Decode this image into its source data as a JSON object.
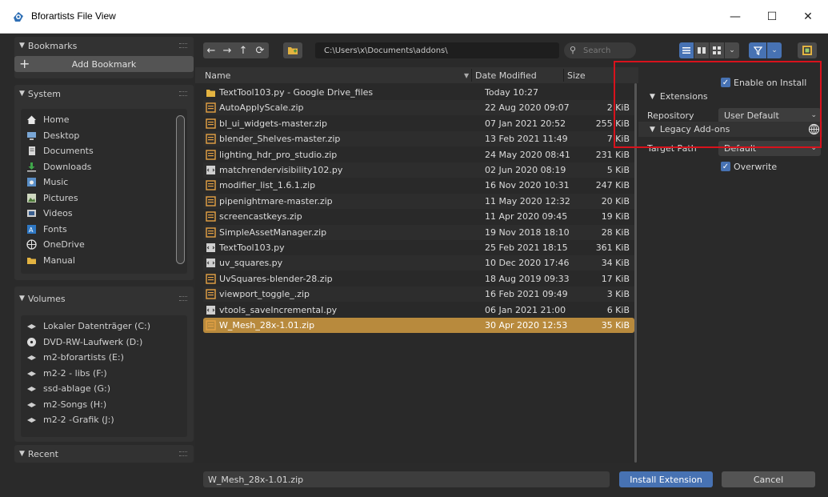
{
  "window": {
    "title": "Bforartists File View",
    "minimize": "—",
    "maximize": "☐",
    "close": "✕"
  },
  "sidebar": {
    "bookmarks": {
      "header": "Bookmarks",
      "add_label": "Add Bookmark"
    },
    "system": {
      "header": "System",
      "items": [
        {
          "label": "Home",
          "icon": "home-icon"
        },
        {
          "label": "Desktop",
          "icon": "desktop-icon"
        },
        {
          "label": "Documents",
          "icon": "documents-icon"
        },
        {
          "label": "Downloads",
          "icon": "downloads-icon"
        },
        {
          "label": "Music",
          "icon": "music-icon"
        },
        {
          "label": "Pictures",
          "icon": "pictures-icon"
        },
        {
          "label": "Videos",
          "icon": "videos-icon"
        },
        {
          "label": "Fonts",
          "icon": "fonts-icon"
        },
        {
          "label": "OneDrive",
          "icon": "onedrive-icon"
        },
        {
          "label": "Manual",
          "icon": "folder-icon"
        }
      ]
    },
    "volumes": {
      "header": "Volumes",
      "items": [
        {
          "label": "Lokaler Datenträger (C:)",
          "icon": "drive-icon"
        },
        {
          "label": "DVD-RW-Laufwerk (D:)",
          "icon": "dvd-icon"
        },
        {
          "label": "m2-bforartists (E:)",
          "icon": "drive-icon"
        },
        {
          "label": "m2-2 - libs (F:)",
          "icon": "drive-icon"
        },
        {
          "label": "ssd-ablage (G:)",
          "icon": "drive-icon"
        },
        {
          "label": "m2-Songs (H:)",
          "icon": "drive-icon"
        },
        {
          "label": "m2-2 -Grafik (J:)",
          "icon": "drive-icon"
        }
      ]
    },
    "recent": {
      "header": "Recent"
    }
  },
  "toolbar": {
    "path": "C:\\Users\\x\\Documents\\addons\\",
    "search_placeholder": "Search"
  },
  "filelist": {
    "columns": {
      "name": "Name",
      "date": "Date Modified",
      "size": "Size"
    },
    "rows": [
      {
        "name": "TextTool103.py - Google Drive_files",
        "date": "Today 10:27",
        "size": "",
        "type": "folder"
      },
      {
        "name": "AutoApplyScale.zip",
        "date": "22 Aug 2020 09:07",
        "size": "2 KiB",
        "type": "zip"
      },
      {
        "name": "bl_ui_widgets-master.zip",
        "date": "07 Jan 2021 20:52",
        "size": "255 KiB",
        "type": "zip"
      },
      {
        "name": "blender_Shelves-master.zip",
        "date": "13 Feb 2021 11:49",
        "size": "7 KiB",
        "type": "zip"
      },
      {
        "name": "lighting_hdr_pro_studio.zip",
        "date": "24 May 2020 08:41",
        "size": "231 KiB",
        "type": "zip"
      },
      {
        "name": "matchrendervisibility102.py",
        "date": "02 Jun 2020 08:19",
        "size": "5 KiB",
        "type": "py"
      },
      {
        "name": "modifier_list_1.6.1.zip",
        "date": "16 Nov 2020 10:31",
        "size": "247 KiB",
        "type": "zip"
      },
      {
        "name": "pipenightmare-master.zip",
        "date": "11 May 2020 12:32",
        "size": "20 KiB",
        "type": "zip"
      },
      {
        "name": "screencastkeys.zip",
        "date": "11 Apr 2020 09:45",
        "size": "19 KiB",
        "type": "zip"
      },
      {
        "name": "SimpleAssetManager.zip",
        "date": "19 Nov 2018 18:10",
        "size": "28 KiB",
        "type": "zip"
      },
      {
        "name": "TextTool103.py",
        "date": "25 Feb 2021 18:15",
        "size": "361 KiB",
        "type": "py"
      },
      {
        "name": "uv_squares.py",
        "date": "10 Dec 2020 17:46",
        "size": "34 KiB",
        "type": "py"
      },
      {
        "name": "UvSquares-blender-28.zip",
        "date": "18 Aug 2019 09:33",
        "size": "17 KiB",
        "type": "zip"
      },
      {
        "name": "viewport_toggle_.zip",
        "date": "16 Feb 2021 09:49",
        "size": "3 KiB",
        "type": "zip"
      },
      {
        "name": "vtools_saveIncremental.py",
        "date": "06 Jan 2021 21:00",
        "size": "6 KiB",
        "type": "py"
      },
      {
        "name": "W_Mesh_28x-1.01.zip",
        "date": "30 Apr 2020 12:53",
        "size": "35 KiB",
        "type": "zip",
        "selected": true
      }
    ]
  },
  "options": {
    "enable_on_install": "Enable on Install",
    "extensions_header": "Extensions",
    "repository_label": "Repository",
    "repository_value": "User Default",
    "legacy_header": "Legacy Add-ons",
    "target_path_label": "Target Path",
    "target_path_value": "Default",
    "overwrite_label": "Overwrite"
  },
  "bottom": {
    "filename": "W_Mesh_28x-1.01.zip",
    "install_label": "Install Extension",
    "cancel_label": "Cancel"
  },
  "colors": {
    "accent": "#4772b3",
    "selection": "#b88a3d",
    "highlight_box": "#d8121c"
  }
}
